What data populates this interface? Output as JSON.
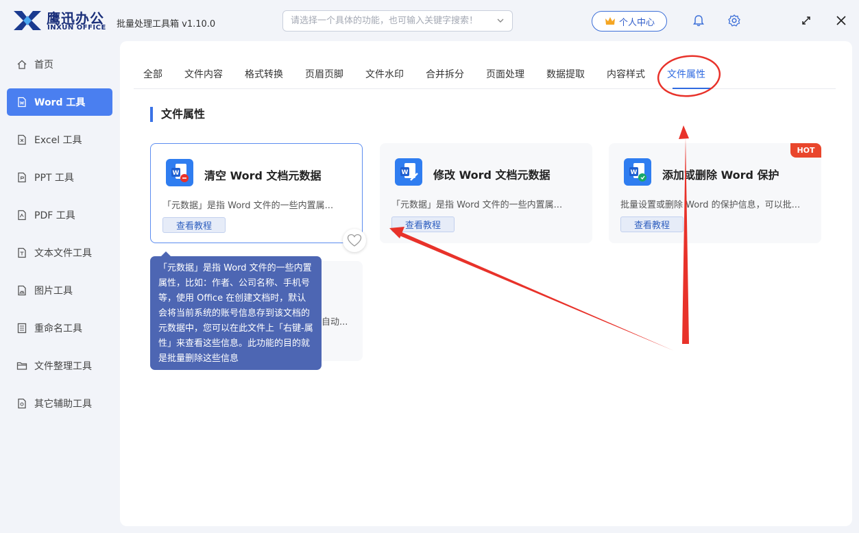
{
  "titlebar": {
    "brand": "鹰迅办公",
    "brand_sub": "INXUN OFFICE",
    "app_title": "批量处理工具箱 v1.10.0",
    "search_placeholder": "请选择一个具体的功能，也可输入关键字搜索！",
    "user_center": "个人中心"
  },
  "sidebar": {
    "items": [
      {
        "label": "首页",
        "icon": "home-icon"
      },
      {
        "label": "Word 工具",
        "icon": "word-file-icon"
      },
      {
        "label": "Excel 工具",
        "icon": "excel-file-icon"
      },
      {
        "label": "PPT 工具",
        "icon": "ppt-file-icon"
      },
      {
        "label": "PDF 工具",
        "icon": "pdf-file-icon"
      },
      {
        "label": "文本文件工具",
        "icon": "text-file-icon"
      },
      {
        "label": "图片工具",
        "icon": "image-file-icon"
      },
      {
        "label": "重命名工具",
        "icon": "rename-icon"
      },
      {
        "label": "文件整理工具",
        "icon": "folder-icon"
      },
      {
        "label": "其它辅助工具",
        "icon": "tools-icon"
      }
    ],
    "active_index": 1
  },
  "tabs": [
    "全部",
    "文件内容",
    "格式转换",
    "页眉页脚",
    "文件水印",
    "合并拆分",
    "页面处理",
    "数据提取",
    "内容样式",
    "文件属性"
  ],
  "active_tab": "文件属性",
  "section_title": "文件属性",
  "cards": [
    {
      "title": "清空 Word 文档元数据",
      "desc": "「元数据」是指 Word 文件的一些内置属...",
      "button": "查看教程",
      "icon": "word-clear-icon"
    },
    {
      "title": "修改 Word 文档元数据",
      "desc": "「元数据」是指 Word 文件的一些内置属...",
      "button": "查看教程",
      "icon": "word-edit-icon"
    },
    {
      "title": "添加或删除 Word 保护",
      "desc": "批量设置或删除 Word 的保护信息，可以批...",
      "button": "查看教程",
      "icon": "word-protect-icon",
      "badge": "HOT"
    },
    {
      "desc": "自动..."
    }
  ],
  "tooltip": {
    "text": "「元数据」是指 Word 文件的一些内置属性，比如：作者、公司名称、手机号等，使用 Office 在创建文档时，默认会将当前系统的账号信息存到该文档的元数据中，您可以在此文件上「右键-属性」来查看这些信息。此功能的目的就是批量删除这些信息"
  },
  "colors": {
    "accent": "#4a7ff0",
    "annotation": "#e8322a",
    "tooltip_bg": "#4d66b3",
    "hot_badge": "#e9462c"
  }
}
